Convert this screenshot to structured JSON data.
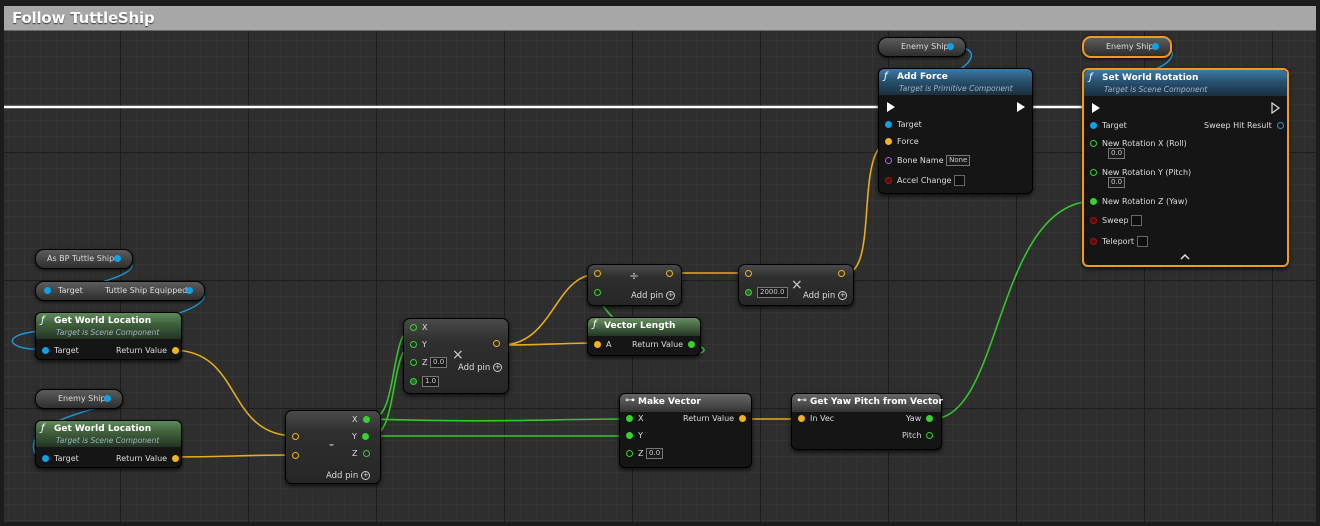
{
  "window_title": "Follow TuttleShip",
  "colors": {
    "object_pin": "#0ea1e6",
    "vector_pin": "#f0b41e",
    "float_pin": "#39d12e",
    "name_pin": "#b060e0",
    "exec": "#ffffff",
    "selection": "#f29a1c"
  },
  "vars": {
    "as_bp": {
      "label": "As BP Tuttle Ship"
    },
    "equipped": {
      "target": "Target",
      "label": "Tuttle Ship Equipped"
    },
    "enemy1": {
      "label": "Enemy Ship"
    },
    "enemy2": {
      "label": "Enemy Ship"
    },
    "enemy3": {
      "label": "Enemy Ship"
    }
  },
  "gwl1": {
    "title": "Get World Location",
    "subtitle": "Target is Scene Component",
    "target": "Target",
    "ret": "Return Value"
  },
  "gwl2": {
    "title": "Get World Location",
    "subtitle": "Target is Scene Component",
    "target": "Target",
    "ret": "Return Value"
  },
  "sub": {
    "symbol": "-",
    "x": "X",
    "y": "Y",
    "z": "Z",
    "add": "Add pin"
  },
  "mul1": {
    "x": "X",
    "y": "Y",
    "z": "Z",
    "z_val": "0.0",
    "w_val": "1.0",
    "symbol": "×",
    "add": "Add pin"
  },
  "div": {
    "symbol": "÷",
    "add": "Add pin"
  },
  "mul2": {
    "val": "2000.0",
    "symbol": "×",
    "add": "Add pin"
  },
  "vlen": {
    "title": "Vector Length",
    "a": "A"
  },
  "mkvec": {
    "title": "Make Vector",
    "x": "X",
    "y": "Y",
    "z": "Z",
    "z_val": "0.0",
    "ret": "Return Value"
  },
  "gypv": {
    "title": "Get Yaw Pitch from Vector",
    "invec": "In Vec",
    "yaw": "Yaw",
    "pitch": "Pitch"
  },
  "addforce": {
    "title": "Add Force",
    "subtitle": "Target is Primitive Component",
    "target": "Target",
    "force": "Force",
    "bone": "Bone Name",
    "bone_val": "None",
    "accel": "Accel Change"
  },
  "swr": {
    "title": "Set World Rotation",
    "subtitle": "Target is Scene Component",
    "target": "Target",
    "sweep_hit": "Sweep Hit Result",
    "rx": "New Rotation X (Roll)",
    "rx_val": "0.0",
    "ry": "New Rotation Y (Pitch)",
    "ry_val": "0.0",
    "rz": "New Rotation Z (Yaw)",
    "sweep": "Sweep",
    "teleport": "Teleport"
  }
}
